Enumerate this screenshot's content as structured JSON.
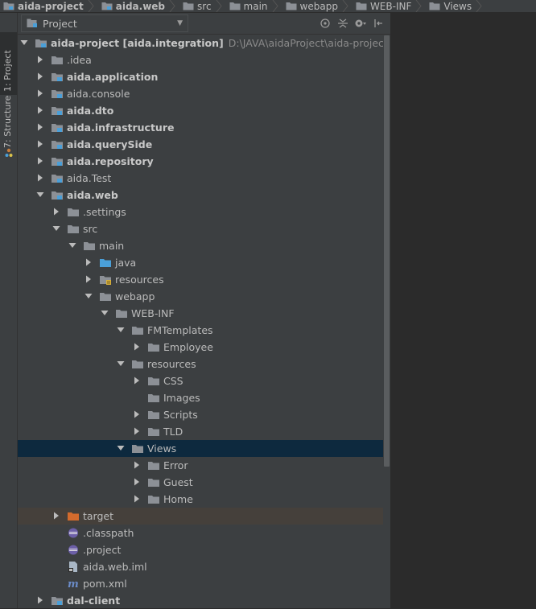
{
  "breadcrumb": [
    {
      "label": "aida-project",
      "bold": true,
      "icon": "module-folder-icon"
    },
    {
      "label": "aida.web",
      "bold": true,
      "icon": "module-folder-icon"
    },
    {
      "label": "src",
      "bold": false,
      "icon": "folder-icon"
    },
    {
      "label": "main",
      "bold": false,
      "icon": "folder-icon"
    },
    {
      "label": "webapp",
      "bold": false,
      "icon": "folder-icon"
    },
    {
      "label": "WEB-INF",
      "bold": false,
      "icon": "folder-icon"
    },
    {
      "label": "Views",
      "bold": false,
      "icon": "folder-icon"
    }
  ],
  "toolstrip": {
    "project_tab": "1: Project",
    "structure_tab": "7: Structure"
  },
  "panel": {
    "view_select": "Project"
  },
  "tree": [
    {
      "label": "aida-project [aida.integration]",
      "path": "D:\\JAVA\\aidaProject\\aida-project",
      "level": 0,
      "arrow": "down",
      "icon": "module",
      "bold": true
    },
    {
      "label": ".idea",
      "level": 1,
      "arrow": "right",
      "icon": "folder"
    },
    {
      "label": "aida.application",
      "level": 1,
      "arrow": "right",
      "icon": "module",
      "bold": true
    },
    {
      "label": "aida.console",
      "level": 1,
      "arrow": "right",
      "icon": "module"
    },
    {
      "label": "aida.dto",
      "level": 1,
      "arrow": "right",
      "icon": "module",
      "bold": true
    },
    {
      "label": "aida.infrastructure",
      "level": 1,
      "arrow": "right",
      "icon": "module",
      "bold": true
    },
    {
      "label": "aida.querySide",
      "level": 1,
      "arrow": "right",
      "icon": "module",
      "bold": true
    },
    {
      "label": "aida.repository",
      "level": 1,
      "arrow": "right",
      "icon": "module",
      "bold": true
    },
    {
      "label": "aida.Test",
      "level": 1,
      "arrow": "right",
      "icon": "module"
    },
    {
      "label": "aida.web",
      "level": 1,
      "arrow": "down",
      "icon": "module",
      "bold": true
    },
    {
      "label": ".settings",
      "level": 2,
      "arrow": "right",
      "icon": "folder"
    },
    {
      "label": "src",
      "level": 2,
      "arrow": "down",
      "icon": "folder"
    },
    {
      "label": "main",
      "level": 3,
      "arrow": "down",
      "icon": "folder"
    },
    {
      "label": "java",
      "level": 4,
      "arrow": "right",
      "icon": "source"
    },
    {
      "label": "resources",
      "level": 4,
      "arrow": "right",
      "icon": "resources"
    },
    {
      "label": "webapp",
      "level": 4,
      "arrow": "down",
      "icon": "folder"
    },
    {
      "label": "WEB-INF",
      "level": 5,
      "arrow": "down",
      "icon": "folder"
    },
    {
      "label": "FMTemplates",
      "level": 6,
      "arrow": "down",
      "icon": "folder"
    },
    {
      "label": "Employee",
      "level": 7,
      "arrow": "right",
      "icon": "folder"
    },
    {
      "label": "resources",
      "level": 6,
      "arrow": "down",
      "icon": "folder"
    },
    {
      "label": "CSS",
      "level": 7,
      "arrow": "right",
      "icon": "folder"
    },
    {
      "label": "Images",
      "level": 7,
      "arrow": "none",
      "icon": "folder"
    },
    {
      "label": "Scripts",
      "level": 7,
      "arrow": "right",
      "icon": "folder"
    },
    {
      "label": "TLD",
      "level": 7,
      "arrow": "right",
      "icon": "folder"
    },
    {
      "label": "Views",
      "level": 6,
      "arrow": "down",
      "icon": "folder",
      "selected": true
    },
    {
      "label": "Error",
      "level": 7,
      "arrow": "right",
      "icon": "folder"
    },
    {
      "label": "Guest",
      "level": 7,
      "arrow": "right",
      "icon": "folder"
    },
    {
      "label": "Home",
      "level": 7,
      "arrow": "right",
      "icon": "folder"
    },
    {
      "label": "target",
      "level": 2,
      "arrow": "right",
      "icon": "excluded",
      "excluded": true
    },
    {
      "label": ".classpath",
      "level": 2,
      "arrow": "none",
      "icon": "eclipse"
    },
    {
      "label": ".project",
      "level": 2,
      "arrow": "none",
      "icon": "eclipse"
    },
    {
      "label": "aida.web.iml",
      "level": 2,
      "arrow": "none",
      "icon": "iml"
    },
    {
      "label": "pom.xml",
      "level": 2,
      "arrow": "none",
      "icon": "maven"
    },
    {
      "label": "dal-client",
      "level": 1,
      "arrow": "right",
      "icon": "module",
      "bold": true
    }
  ],
  "colors": {
    "folder": "#8c9096",
    "source": "#4a9fd8",
    "excluded": "#d36b2d",
    "module_dot": "#4a9fd8",
    "eclipse": "#6c5fa8",
    "maven": "#6b8cc9"
  }
}
